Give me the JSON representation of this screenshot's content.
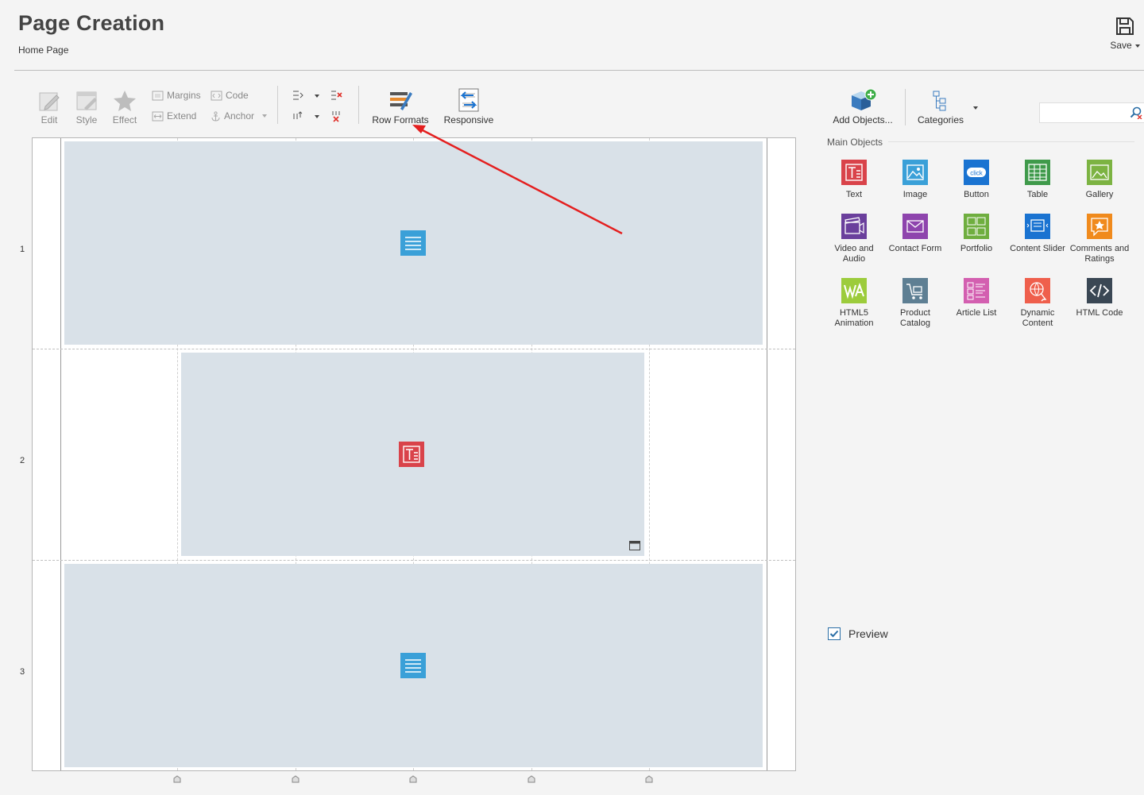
{
  "header": {
    "title": "Page Creation",
    "breadcrumb": "Home Page",
    "save_label": "Save"
  },
  "toolbar": {
    "edit_label": "Edit",
    "style_label": "Style",
    "effect_label": "Effect",
    "margins_label": "Margins",
    "extend_label": "Extend",
    "code_label": "Code",
    "anchor_label": "Anchor",
    "row_formats_label": "Row Formats",
    "responsive_label": "Responsive",
    "add_objects_label": "Add Objects...",
    "categories_label": "Categories"
  },
  "canvas": {
    "rows": [
      "1",
      "2",
      "3"
    ]
  },
  "panel": {
    "section_title": "Main Objects",
    "objects": [
      {
        "label": "Text",
        "color": "#d9434a"
      },
      {
        "label": "Image",
        "color": "#3aa0d8"
      },
      {
        "label": "Button",
        "color": "#1a73d1"
      },
      {
        "label": "Table",
        "color": "#3f9a4b"
      },
      {
        "label": "Gallery",
        "color": "#7cb342"
      },
      {
        "label": "Video and Audio",
        "color": "#6a3f9c"
      },
      {
        "label": "Contact Form",
        "color": "#8e44ad"
      },
      {
        "label": "Portfolio",
        "color": "#6fae3f"
      },
      {
        "label": "Content Slider",
        "color": "#1a73d1"
      },
      {
        "label": "Comments and Ratings",
        "color": "#f08a1c"
      },
      {
        "label": "HTML5 Animation",
        "color": "#9ccc3c"
      },
      {
        "label": "Product Catalog",
        "color": "#5e7f93"
      },
      {
        "label": "Article List",
        "color": "#d35fb0"
      },
      {
        "label": "Dynamic Content",
        "color": "#ef5f4c"
      },
      {
        "label": "HTML Code",
        "color": "#3a4754"
      }
    ],
    "preview_label": "Preview",
    "preview_checked": true
  },
  "colors": {
    "accent": "#2a6ea6",
    "block_fill": "#d9e1e8",
    "annotation_arrow": "#e41f1f"
  }
}
